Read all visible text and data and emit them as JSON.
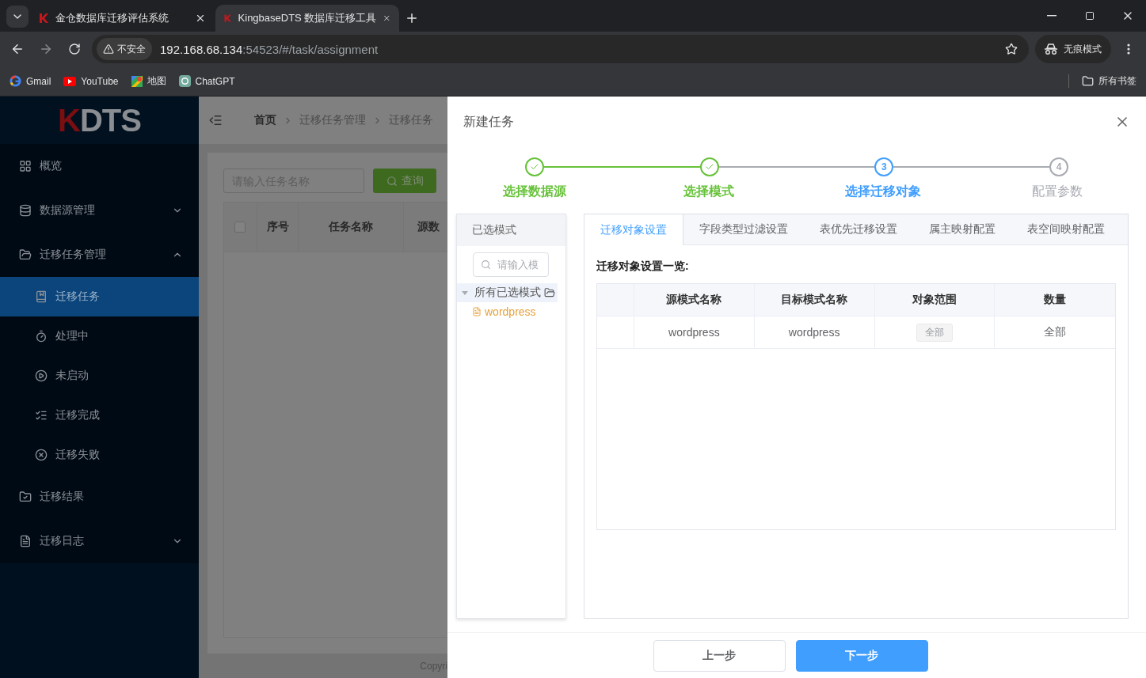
{
  "browser": {
    "tabs": [
      {
        "title": "金仓数据库迁移评估系统",
        "selected": false
      },
      {
        "title": "KingbaseDTS 数据库迁移工具",
        "selected": true
      }
    ],
    "address": {
      "security": "不安全",
      "host": "192.168.68.134",
      "path": ":54523/#/task/assignment"
    },
    "profile": "无痕模式",
    "bookmarks": [
      "Gmail",
      "YouTube",
      "地图",
      "ChatGPT"
    ],
    "all_bookmarks": "所有书签"
  },
  "logo": {
    "accent": "K",
    "text": "DTS"
  },
  "sidebar": {
    "items": [
      {
        "label": "概览",
        "kind": "link",
        "selected": false
      },
      {
        "label": "数据源管理",
        "kind": "group",
        "expanded": false
      },
      {
        "label": "迁移任务管理",
        "kind": "group",
        "expanded": true,
        "children": [
          {
            "label": "迁移任务",
            "selected": true
          },
          {
            "label": "处理中",
            "selected": false
          },
          {
            "label": "未启动",
            "selected": false
          },
          {
            "label": "迁移完成",
            "selected": false
          },
          {
            "label": "迁移失败",
            "selected": false
          }
        ]
      },
      {
        "label": "迁移结果",
        "kind": "link",
        "selected": false
      },
      {
        "label": "迁移日志",
        "kind": "group",
        "expanded": false
      }
    ]
  },
  "breadcrumb": [
    "首页",
    "迁移任务管理",
    "迁移任务"
  ],
  "task_list": {
    "search": {
      "placeholder": "请输入任务名称"
    },
    "query_button": "查询",
    "header_checkbox": {
      "checked": false
    },
    "columns": [
      "序号",
      "任务名称",
      "源数"
    ],
    "footer": "Copyri"
  },
  "dialog": {
    "title": "新建任务",
    "steps": [
      {
        "label": "选择数据源",
        "finished": true,
        "current": false
      },
      {
        "label": "选择模式",
        "finished": true,
        "current": false
      },
      {
        "label": "选择迁移对象",
        "number": "3",
        "finished": false,
        "current": true
      },
      {
        "label": "配置参数",
        "number": "4",
        "finished": false,
        "current": false
      }
    ],
    "schema_panel": {
      "title": "已选模式",
      "search": {
        "placeholder": "请输入模"
      },
      "tree": {
        "label": "所有已选模式",
        "expanded": true,
        "selected": true,
        "children": [
          {
            "label": "wordpress",
            "selected": false
          }
        ]
      }
    },
    "tabs": [
      {
        "label": "迁移对象设置",
        "selected": true
      },
      {
        "label": "字段类型过滤设置",
        "selected": false
      },
      {
        "label": "表优先迁移设置",
        "selected": false
      },
      {
        "label": "属主映射配置",
        "selected": false
      },
      {
        "label": "表空间映射配置",
        "selected": false
      }
    ],
    "section_title": "迁移对象设置一览:",
    "table": {
      "columns": [
        "源模式名称",
        "目标模式名称",
        "对象范围",
        "数量"
      ],
      "rows": [
        {
          "source": "wordpress",
          "target": "wordpress",
          "scope": "全部",
          "count": "全部"
        }
      ]
    },
    "buttons": [
      {
        "label": "上一步",
        "kind": "default"
      },
      {
        "label": "下一步",
        "kind": "primary"
      }
    ]
  }
}
